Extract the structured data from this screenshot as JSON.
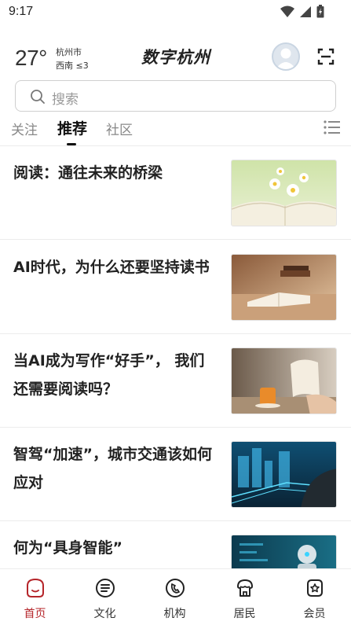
{
  "status_bar": {
    "time": "9:17"
  },
  "header": {
    "temperature": "27°",
    "city": "杭州市",
    "wind": "西南 ≤3",
    "app_title": "数字杭州"
  },
  "search": {
    "placeholder": "搜索"
  },
  "tabs": [
    {
      "label": "关注",
      "active": false
    },
    {
      "label": "推荐",
      "active": true
    },
    {
      "label": "社区",
      "active": false
    }
  ],
  "articles": [
    {
      "title": "阅读：通往未来的桥梁",
      "image": "open-book-flowers"
    },
    {
      "title": "AI时代，为什么还要坚持读书",
      "image": "open-book-desk"
    },
    {
      "title": "当AI成为写作“好手”， 我们还需要阅读吗？",
      "image": "reading-coffee"
    },
    {
      "title": "智驾“加速”，城市交通该如何应对",
      "image": "smart-driving"
    },
    {
      "title": "何为“具身智能”",
      "image": "robot"
    }
  ],
  "bottom_nav": [
    {
      "label": "首页",
      "icon": "home-icon",
      "active": true
    },
    {
      "label": "文化",
      "icon": "culture-icon",
      "active": false
    },
    {
      "label": "机构",
      "icon": "institution-icon",
      "active": false
    },
    {
      "label": "居民",
      "icon": "resident-icon",
      "active": false
    },
    {
      "label": "会员",
      "icon": "member-icon",
      "active": false
    }
  ],
  "colors": {
    "accent": "#b5252a",
    "text": "#222222",
    "muted": "#888888"
  }
}
